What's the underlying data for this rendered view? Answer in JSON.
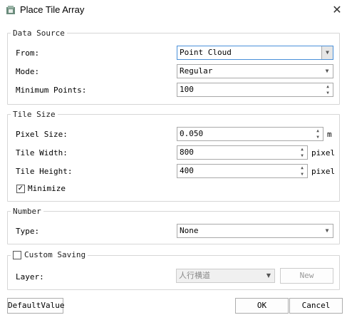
{
  "window": {
    "title": "Place Tile Array",
    "close_glyph": "✕"
  },
  "data_source": {
    "legend": "Data Source",
    "from_label": "From:",
    "from_value": "Point Cloud",
    "mode_label": "Mode:",
    "mode_value": "Regular",
    "min_points_label": "Minimum Points:",
    "min_points_value": "100"
  },
  "tile_size": {
    "legend": "Tile Size",
    "pixel_size_label": "Pixel Size:",
    "pixel_size_value": "0.050",
    "pixel_size_unit": "m",
    "tile_width_label": "Tile Width:",
    "tile_width_value": "800",
    "tile_width_unit": "pixel",
    "tile_height_label": "Tile Height:",
    "tile_height_value": "400",
    "tile_height_unit": "pixel",
    "minimize_label": "Minimize",
    "minimize_checked": true
  },
  "number": {
    "legend": "Number",
    "type_label": "Type:",
    "type_value": "None"
  },
  "custom_saving": {
    "legend": "Custom Saving",
    "checked": false,
    "layer_label": "Layer:",
    "layer_value": "人行横道",
    "new_button": "New"
  },
  "footer": {
    "default_button": "DefaultValue",
    "ok_button": "OK",
    "cancel_button": "Cancel"
  },
  "icons": {
    "app": "app-icon",
    "combo": "chevron-down-icon",
    "spin": "spin-arrows-icon",
    "check": "checkmark-icon"
  },
  "colors": {
    "active_border": "#4a90d9",
    "border": "#a9a9a9",
    "group_border": "#d6d6d6"
  }
}
